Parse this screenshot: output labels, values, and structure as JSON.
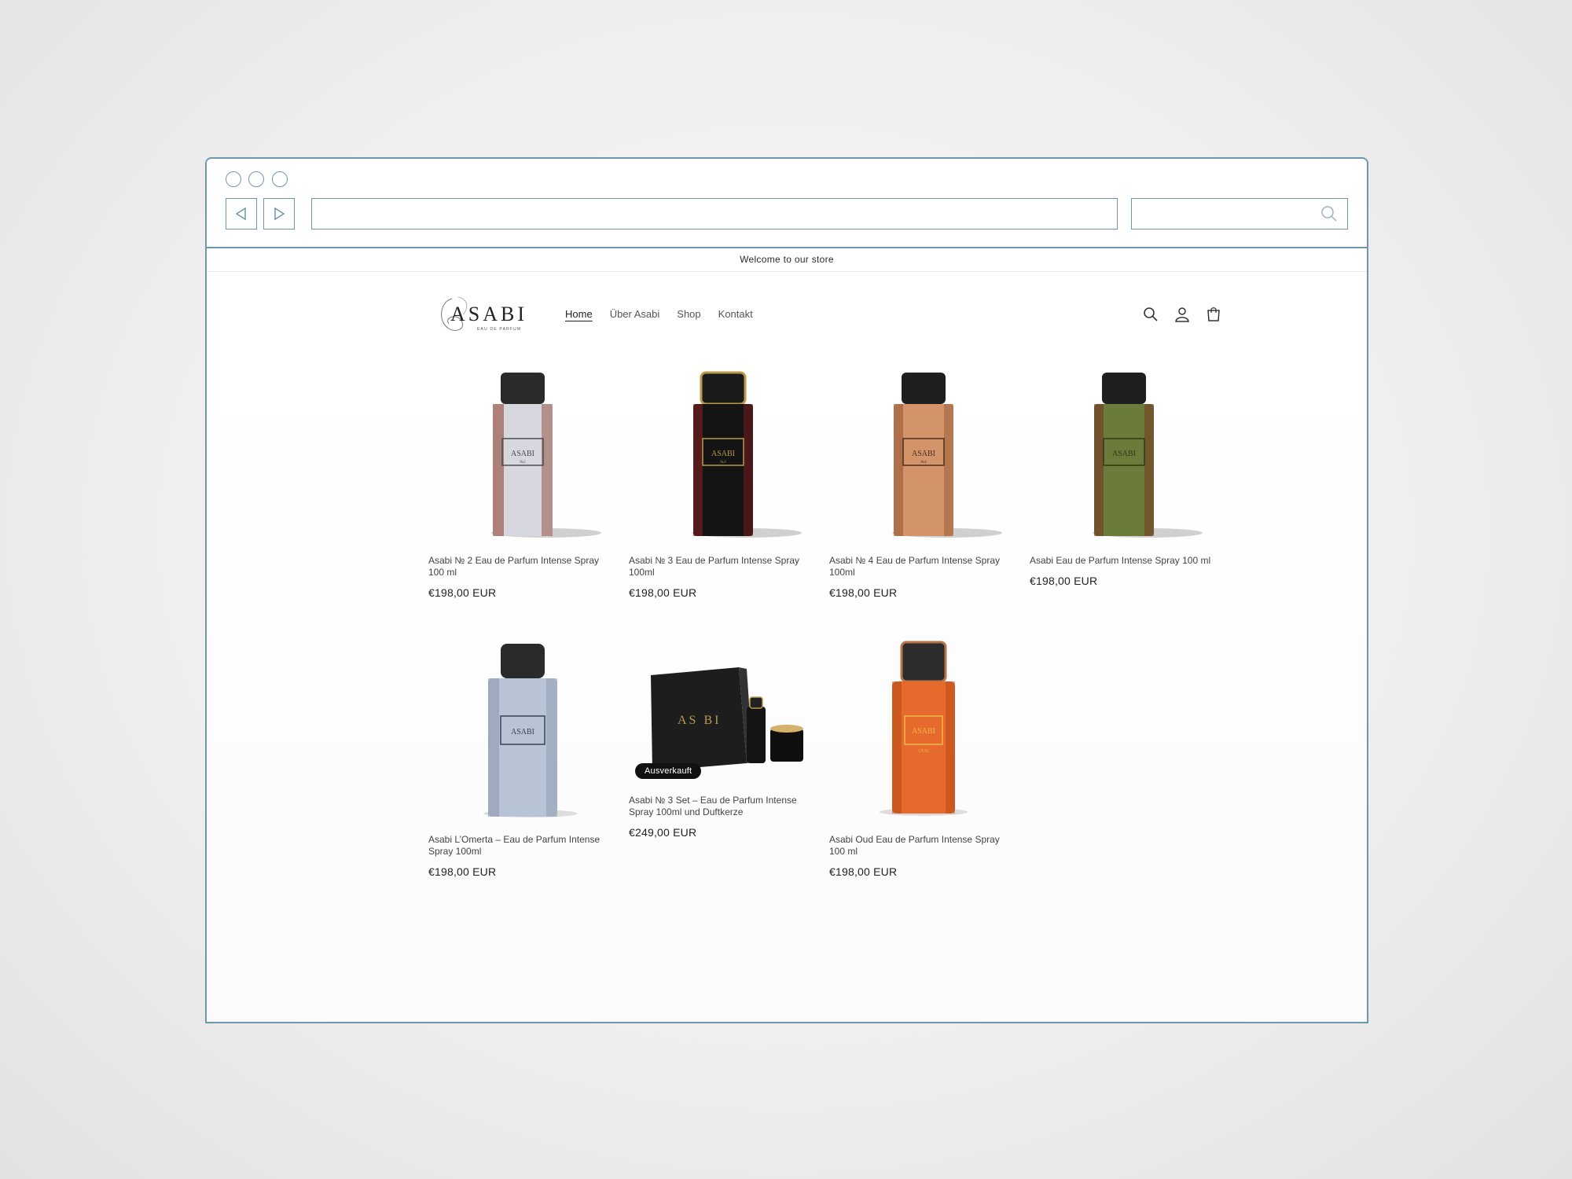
{
  "store": {
    "announcement": "Welcome to our store",
    "logo": {
      "text": "ASABI",
      "subtext": "EAU DE PARFUM"
    },
    "nav": [
      {
        "label": "Home",
        "active": true
      },
      {
        "label": "Über Asabi",
        "active": false
      },
      {
        "label": "Shop",
        "active": false
      },
      {
        "label": "Kontakt",
        "active": false
      }
    ],
    "header_icons": [
      "search-icon",
      "account-icon",
      "cart-icon"
    ]
  },
  "products": [
    {
      "title": "Asabi № 2 Eau de Parfum Intense Spray 100 ml",
      "price": "€198,00 EUR",
      "label_text": "ASABI",
      "label_num": "№2",
      "bottle_color": "#d7d7df",
      "accent": "#4a4a55",
      "badge": ""
    },
    {
      "title": "Asabi № 3 Eau de Parfum Intense Spray 100ml",
      "price": "€198,00 EUR",
      "label_text": "ASABI",
      "label_num": "№3",
      "bottle_color": "#141414",
      "accent": "#b89a4c",
      "badge": ""
    },
    {
      "title": "Asabi № 4 Eau de Parfum Intense Spray 100ml",
      "price": "€198,00 EUR",
      "label_text": "ASABI",
      "label_num": "№4",
      "bottle_color": "#d3946a",
      "accent": "#4b2e1e",
      "badge": ""
    },
    {
      "title": "Asabi Eau de Parfum Intense Spray 100 ml",
      "price": "€198,00 EUR",
      "label_text": "ASABI",
      "label_num": "",
      "bottle_color": "#6b7c3a",
      "accent": "#2f3818",
      "badge": ""
    },
    {
      "title": "Asabi L’Omerta – Eau de Parfum Intense Spray 100ml",
      "price": "€198,00 EUR",
      "label_text": "ASABI",
      "label_num": "",
      "bottle_color": "#b8c4d6",
      "accent": "#3b4150",
      "badge": ""
    },
    {
      "title": "Asabi № 3 Set – Eau de Parfum Intense Spray 100ml und Duftkerze",
      "price": "€249,00 EUR",
      "label_text": "AS BI",
      "label_num": "",
      "bottle_color": "#1a1a1a",
      "accent": "#b89a4c",
      "badge": "Ausverkauft"
    },
    {
      "title": "Asabi Oud Eau de Parfum Intense Spray 100 ml",
      "price": "€198,00 EUR",
      "label_text": "ASABI",
      "label_num": "OUD",
      "bottle_color": "#e66a2c",
      "accent": "#f2b84a",
      "badge": ""
    }
  ]
}
